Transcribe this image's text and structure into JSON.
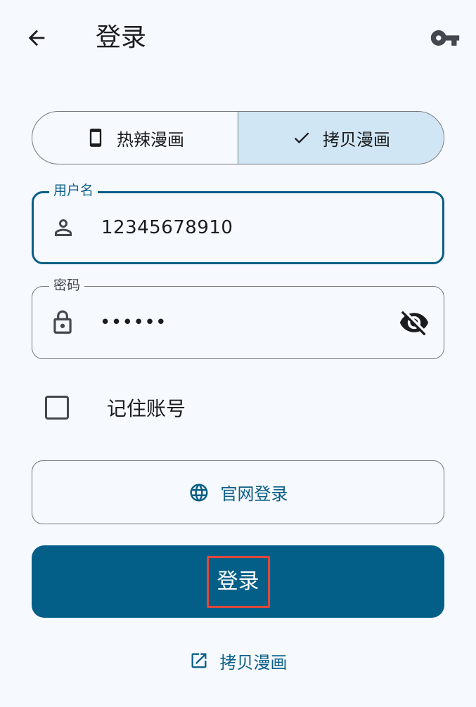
{
  "appbar": {
    "title": "登录",
    "back_icon": "arrow-back-icon",
    "action_icon": "key-icon"
  },
  "segmented": {
    "items": [
      {
        "label": "热辣漫画",
        "icon": "phone-icon",
        "selected": false
      },
      {
        "label": "拷贝漫画",
        "icon": "check-icon",
        "selected": true
      }
    ]
  },
  "username": {
    "label": "用户名",
    "value": "12345678910",
    "icon": "person-icon"
  },
  "password": {
    "label": "密码",
    "value": "••••••",
    "icon": "lock-icon",
    "toggle_icon": "visibility-off-icon"
  },
  "remember": {
    "label": "记住账号",
    "checked": false
  },
  "web_login": {
    "label": "官网登录",
    "icon": "globe-icon"
  },
  "login_button": {
    "label": "登录"
  },
  "footer_link": {
    "label": "拷贝漫画",
    "icon": "open-in-new-icon"
  },
  "colors": {
    "primary": "#035f88",
    "accent_text": "#0b5f87",
    "selected_segment": "#d1e6f5",
    "background": "#f6f9fd",
    "highlight_box": "#e0473a"
  }
}
